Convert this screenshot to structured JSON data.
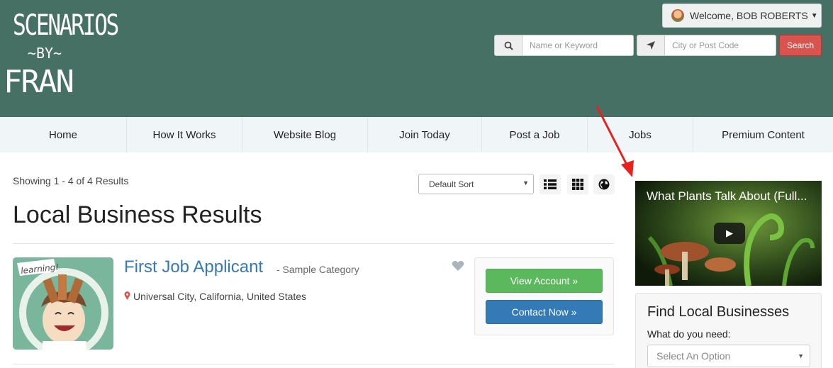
{
  "brand": {
    "line1": "SCENARIOS",
    "line2": "~BY~",
    "line3": "FRAN"
  },
  "user": {
    "welcome": "Welcome, BOB ROBERTS"
  },
  "search": {
    "keyword_placeholder": "Name or Keyword",
    "location_placeholder": "City or Post Code",
    "button": "Search"
  },
  "nav": {
    "items": [
      {
        "label": "Home"
      },
      {
        "label": "How It Works"
      },
      {
        "label": "Website Blog"
      },
      {
        "label": "Join Today"
      },
      {
        "label": "Post a Job"
      },
      {
        "label": "Jobs"
      },
      {
        "label": "Premium Content"
      }
    ]
  },
  "results": {
    "showing": "Showing 1 - 4 of 4 Results",
    "sort_value": "Default Sort",
    "title": "Local Business Results"
  },
  "listing": {
    "name": "First Job Applicant",
    "category": "- Sample Category",
    "location": "Universal City, California, United States",
    "thumb_text": "learning!",
    "view_button": "View Account »",
    "contact_button": "Contact Now »"
  },
  "video": {
    "title": "What Plants Talk About (Full..."
  },
  "widget": {
    "title": "Find Local Businesses",
    "label": "What do you need:",
    "select_value": "Select An Option"
  },
  "colors": {
    "header": "#467063",
    "nav": "#f0f6f8",
    "danger": "#d9534f",
    "success": "#5cb85c",
    "primary": "#337ab7"
  }
}
